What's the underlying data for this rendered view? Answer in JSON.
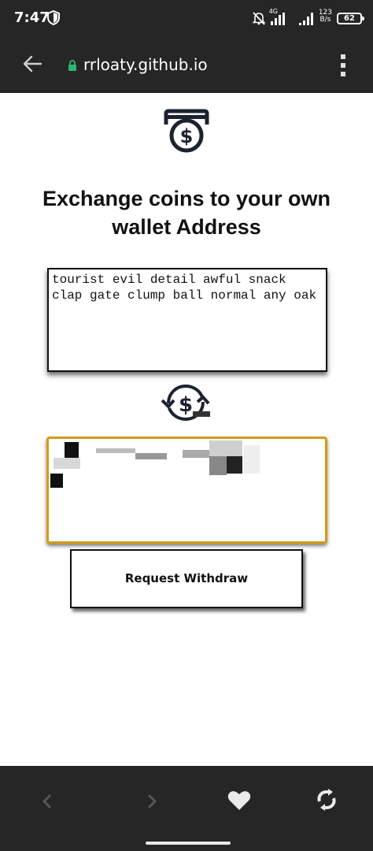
{
  "status_bar": {
    "time": "7:47",
    "network": "4G",
    "speed_value": "123",
    "speed_unit": "B/s",
    "battery": "62"
  },
  "url_bar": {
    "url": "rrloaty.github.io"
  },
  "page": {
    "title": "Exchange coins to your own wallet Address",
    "seed_phrase": "tourist evil detail awful snack clap gate clump ball normal any oak",
    "withdraw_button": "Request Withdraw",
    "wallet_border_color": "#d39b16"
  },
  "icons": {
    "atm": "atm-dollar-icon",
    "exchange": "dollar-exchange-icon",
    "lock_color": "#2bb673"
  }
}
